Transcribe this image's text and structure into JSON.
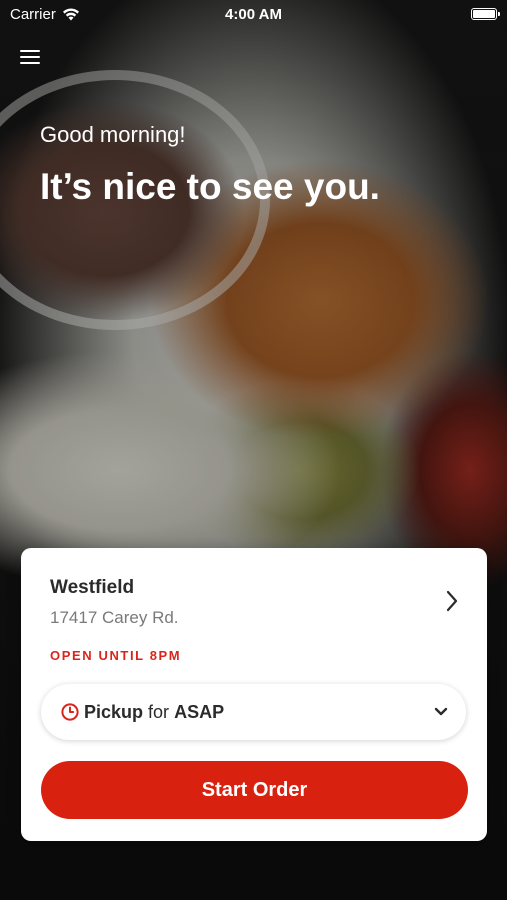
{
  "status_bar": {
    "carrier": "Carrier",
    "time": "4:00 AM"
  },
  "hero": {
    "greeting": "Good morning!",
    "headline": "It’s nice to see you."
  },
  "location": {
    "name": "Westfield",
    "address": "17417 Carey Rd.",
    "open_status": "OPEN UNTIL 8PM"
  },
  "order_mode": {
    "mode": "Pickup",
    "connector": "for",
    "time": "ASAP"
  },
  "actions": {
    "start_order_label": "Start Order"
  },
  "colors": {
    "accent": "#d9210f",
    "open_status": "#d9261c"
  },
  "icons": {
    "menu": "hamburger-menu-icon",
    "wifi": "wifi-icon",
    "battery": "battery-icon",
    "location_chevron": "chevron-right-icon",
    "clock": "clock-icon",
    "dropdown": "chevron-down-icon"
  }
}
